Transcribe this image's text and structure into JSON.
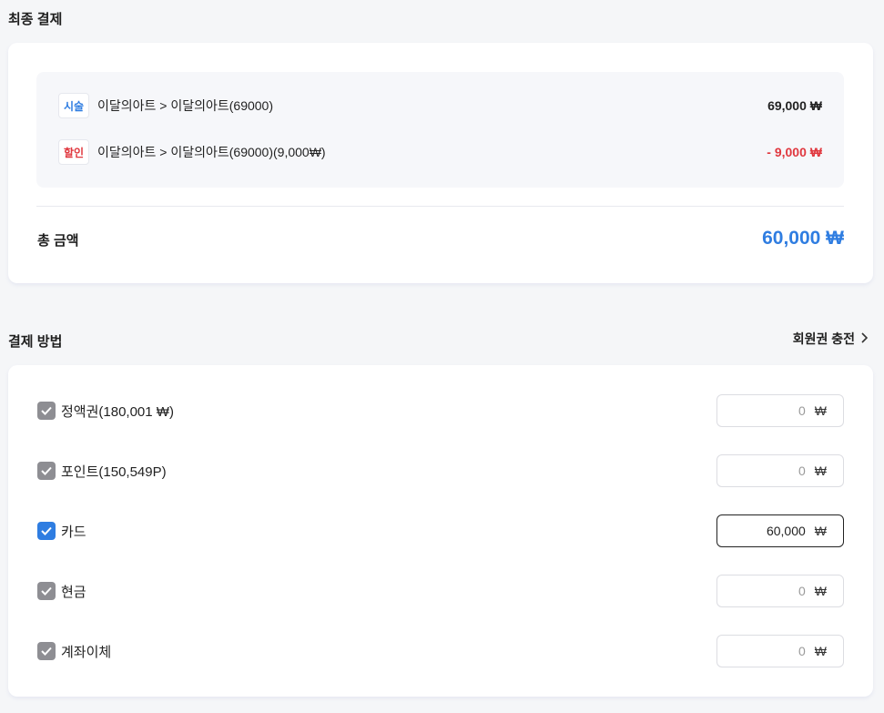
{
  "final_payment": {
    "title": "최종 결제",
    "items": [
      {
        "tag": "시술",
        "text": "이달의아트 > 이달의아트(69000)",
        "amount": "69,000 ₩"
      },
      {
        "tag": "할인",
        "text": "이달의아트 > 이달의아트(69000)(9,000₩)",
        "amount": "- 9,000 ₩"
      }
    ],
    "total_label": "총 금액",
    "total_value": "60,000 ₩"
  },
  "payment_method": {
    "title": "결제 방법",
    "recharge_label": "회원권 충전",
    "currency": "₩",
    "rows": [
      {
        "label": "정액권(180,001 ₩)",
        "value": "0",
        "checked": false
      },
      {
        "label": "포인트(150,549P)",
        "value": "0",
        "checked": false
      },
      {
        "label": "카드",
        "value": "60,000",
        "checked": true
      },
      {
        "label": "현금",
        "value": "0",
        "checked": false
      },
      {
        "label": "계좌이체",
        "value": "0",
        "checked": false
      }
    ]
  },
  "colors": {
    "accent": "#2f7de1",
    "discount": "#e0383f",
    "unchecked": "#8e8e93"
  },
  "icons": {
    "checkbox": "check-icon",
    "recharge": "chevron-right-icon"
  }
}
